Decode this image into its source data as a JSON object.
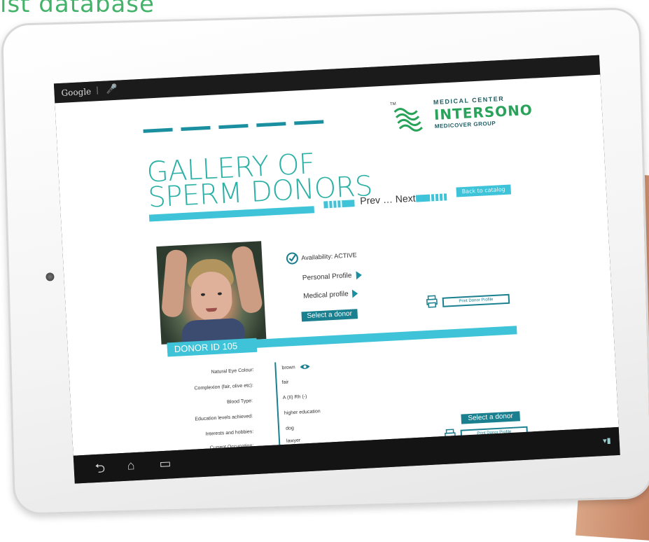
{
  "top_fragment": "ist database",
  "android": {
    "search_brand": "Google",
    "separator": "|",
    "mic_icon": "mic-icon"
  },
  "logo": {
    "tm": "TM",
    "line1": "MEDICAL CENTER",
    "line2": "INTERSONO",
    "line3": "MEDICOVER GROUP",
    "mark_color": "#2aa35a"
  },
  "page": {
    "title_line1": "GALLERY OF",
    "title_line2": "SPERM DONORS",
    "prev_next": "Prev … Next",
    "back_to_catalog": "Back to catalog"
  },
  "donor": {
    "id_label": "DONOR ID 105",
    "availability": "Availability: ACTIVE",
    "personal_profile": "Personal Profile",
    "medical_profile": "Medical profile",
    "select_donor": "Select a donor",
    "print_profile": "Print Donor Profile"
  },
  "details": {
    "rows": [
      {
        "label": "Natural Eye Colour:",
        "value": "brown"
      },
      {
        "label": "Complexion (fair, olive etc):",
        "value": "fair"
      },
      {
        "label": "Blood Type:",
        "value": "A (II) Rh (-)"
      },
      {
        "label": "Education levels achieved:",
        "value": "higher education"
      },
      {
        "label": "Interests and hobbies:",
        "value": "dog"
      },
      {
        "label": "Current Occupation:",
        "value": "lawyer"
      }
    ],
    "select_donor": "Select a donor",
    "print_profile": "Print Donor Profile"
  },
  "colors": {
    "accent": "#3fc3d8",
    "dark_accent": "#1a7f8f",
    "title": "#2bb0a6",
    "brand_green": "#2aa35a"
  },
  "nav_icons": [
    "back-icon",
    "home-icon",
    "recent-apps-icon"
  ]
}
